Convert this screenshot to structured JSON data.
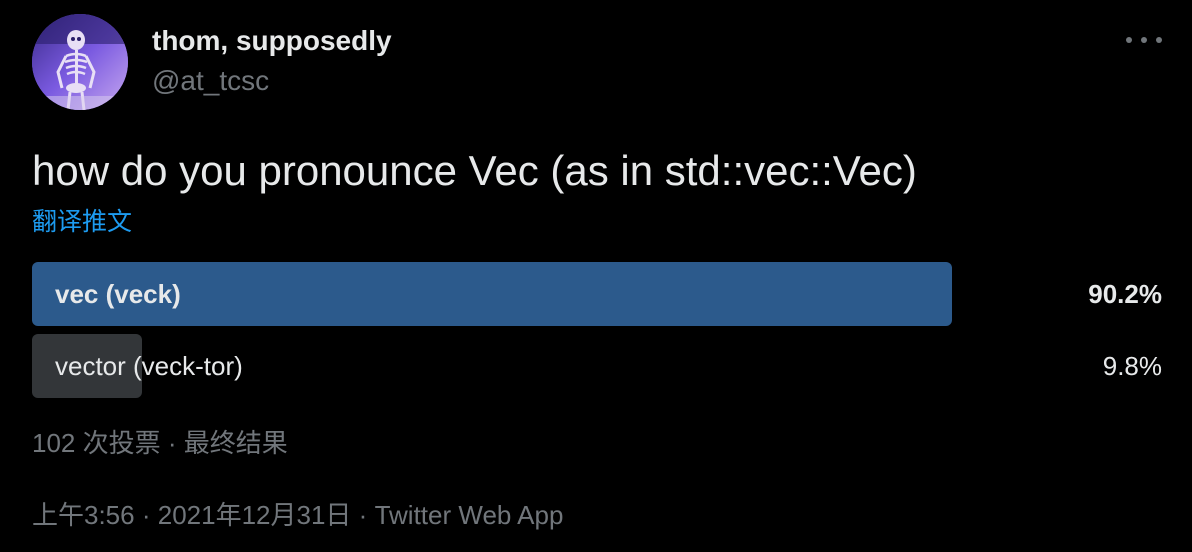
{
  "author": {
    "display_name": "thom, supposedly",
    "handle": "@at_tcsc",
    "avatar_icon": "skeleton-avatar-icon"
  },
  "more_icon": "more-horizontal-icon",
  "tweet": {
    "text": "how do you pronounce Vec (as in std::vec::Vec)",
    "translate_label": "翻译推文"
  },
  "poll": {
    "options": [
      {
        "label": "vec (veck)",
        "percent_text": "90.2%",
        "percent": 90.2,
        "winner": true
      },
      {
        "label": "vector (veck-tor)",
        "percent_text": "9.8%",
        "percent": 9.8,
        "winner": false
      }
    ],
    "votes": "102 次投票",
    "separator": "·",
    "status": "最终结果"
  },
  "meta": {
    "time": "上午3:56",
    "date": "2021年12月31日",
    "source": "Twitter Web App",
    "separator": "·"
  },
  "colors": {
    "background": "#000000",
    "winner_bar": "#2c5a8c",
    "other_bar": "#333639",
    "link": "#1d9bf0",
    "muted": "#71767b",
    "text": "#e7e9ea"
  }
}
